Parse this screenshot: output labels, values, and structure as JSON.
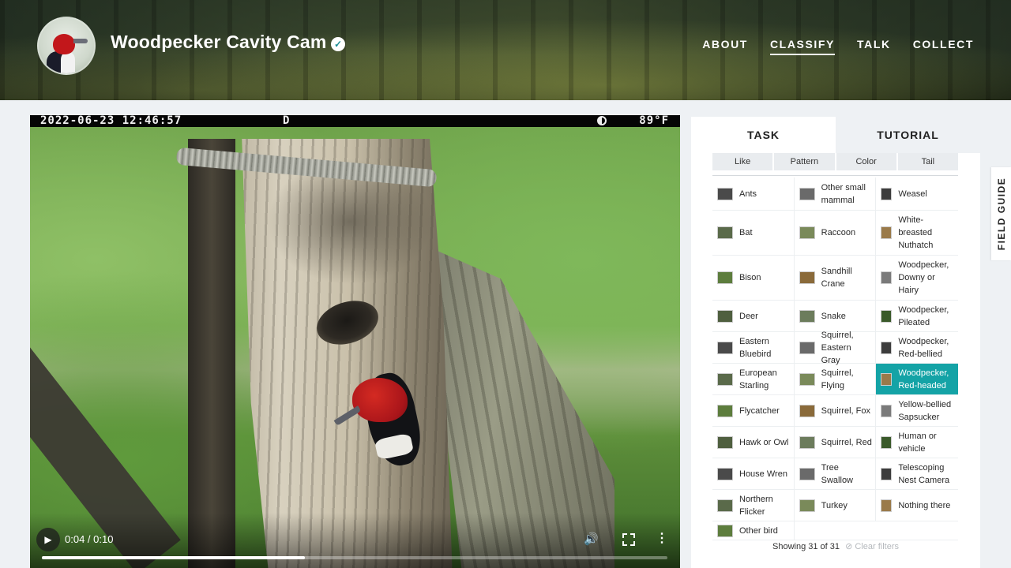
{
  "header": {
    "project_title": "Woodpecker Cavity Cam",
    "verified_icon": "check-badge-icon",
    "nav": [
      {
        "label": "ABOUT",
        "active": false
      },
      {
        "label": "CLASSIFY",
        "active": true
      },
      {
        "label": "TALK",
        "active": false
      },
      {
        "label": "COLLECT",
        "active": false
      }
    ]
  },
  "video": {
    "osd_timestamp": "2022-06-23 12:46:57",
    "osd_mode": "D",
    "osd_temperature": "89°F",
    "time_display": "0:04 / 0:10",
    "progress_fraction": 0.42
  },
  "panel": {
    "tabs": [
      {
        "label": "TASK",
        "active": true
      },
      {
        "label": "TUTORIAL",
        "active": false
      }
    ],
    "filters": [
      "Like",
      "Pattern",
      "Color",
      "Tail"
    ],
    "choices": [
      [
        "Ants",
        "Other small mammal",
        "Weasel"
      ],
      [
        "Bat",
        "Raccoon",
        "White-breasted Nuthatch"
      ],
      [
        "Bison",
        "Sandhill Crane",
        "Woodpecker, Downy or Hairy"
      ],
      [
        "Deer",
        "Snake",
        "Woodpecker, Pileated"
      ],
      [
        "Eastern Bluebird",
        "Squirrel, Eastern Gray",
        "Woodpecker, Red-bellied"
      ],
      [
        "European Starling",
        "Squirrel, Flying",
        "Woodpecker, Red-headed"
      ],
      [
        "Flycatcher",
        "Squirrel, Fox",
        "Yellow-bellied Sapsucker"
      ],
      [
        "Hawk or Owl",
        "Squirrel, Red",
        "Human or vehicle"
      ],
      [
        "House Wren",
        "Tree Swallow",
        "Telescoping Nest Camera"
      ],
      [
        "Northern Flicker",
        "Turkey",
        "Nothing there"
      ],
      [
        "Other bird"
      ]
    ],
    "selected_choice": "Woodpecker, Red-headed",
    "showing_text": "Showing 31 of 31",
    "clear_filters": "Clear filters",
    "accent_color": "#14a3a6"
  },
  "field_guide_label": "FIELD GUIDE"
}
